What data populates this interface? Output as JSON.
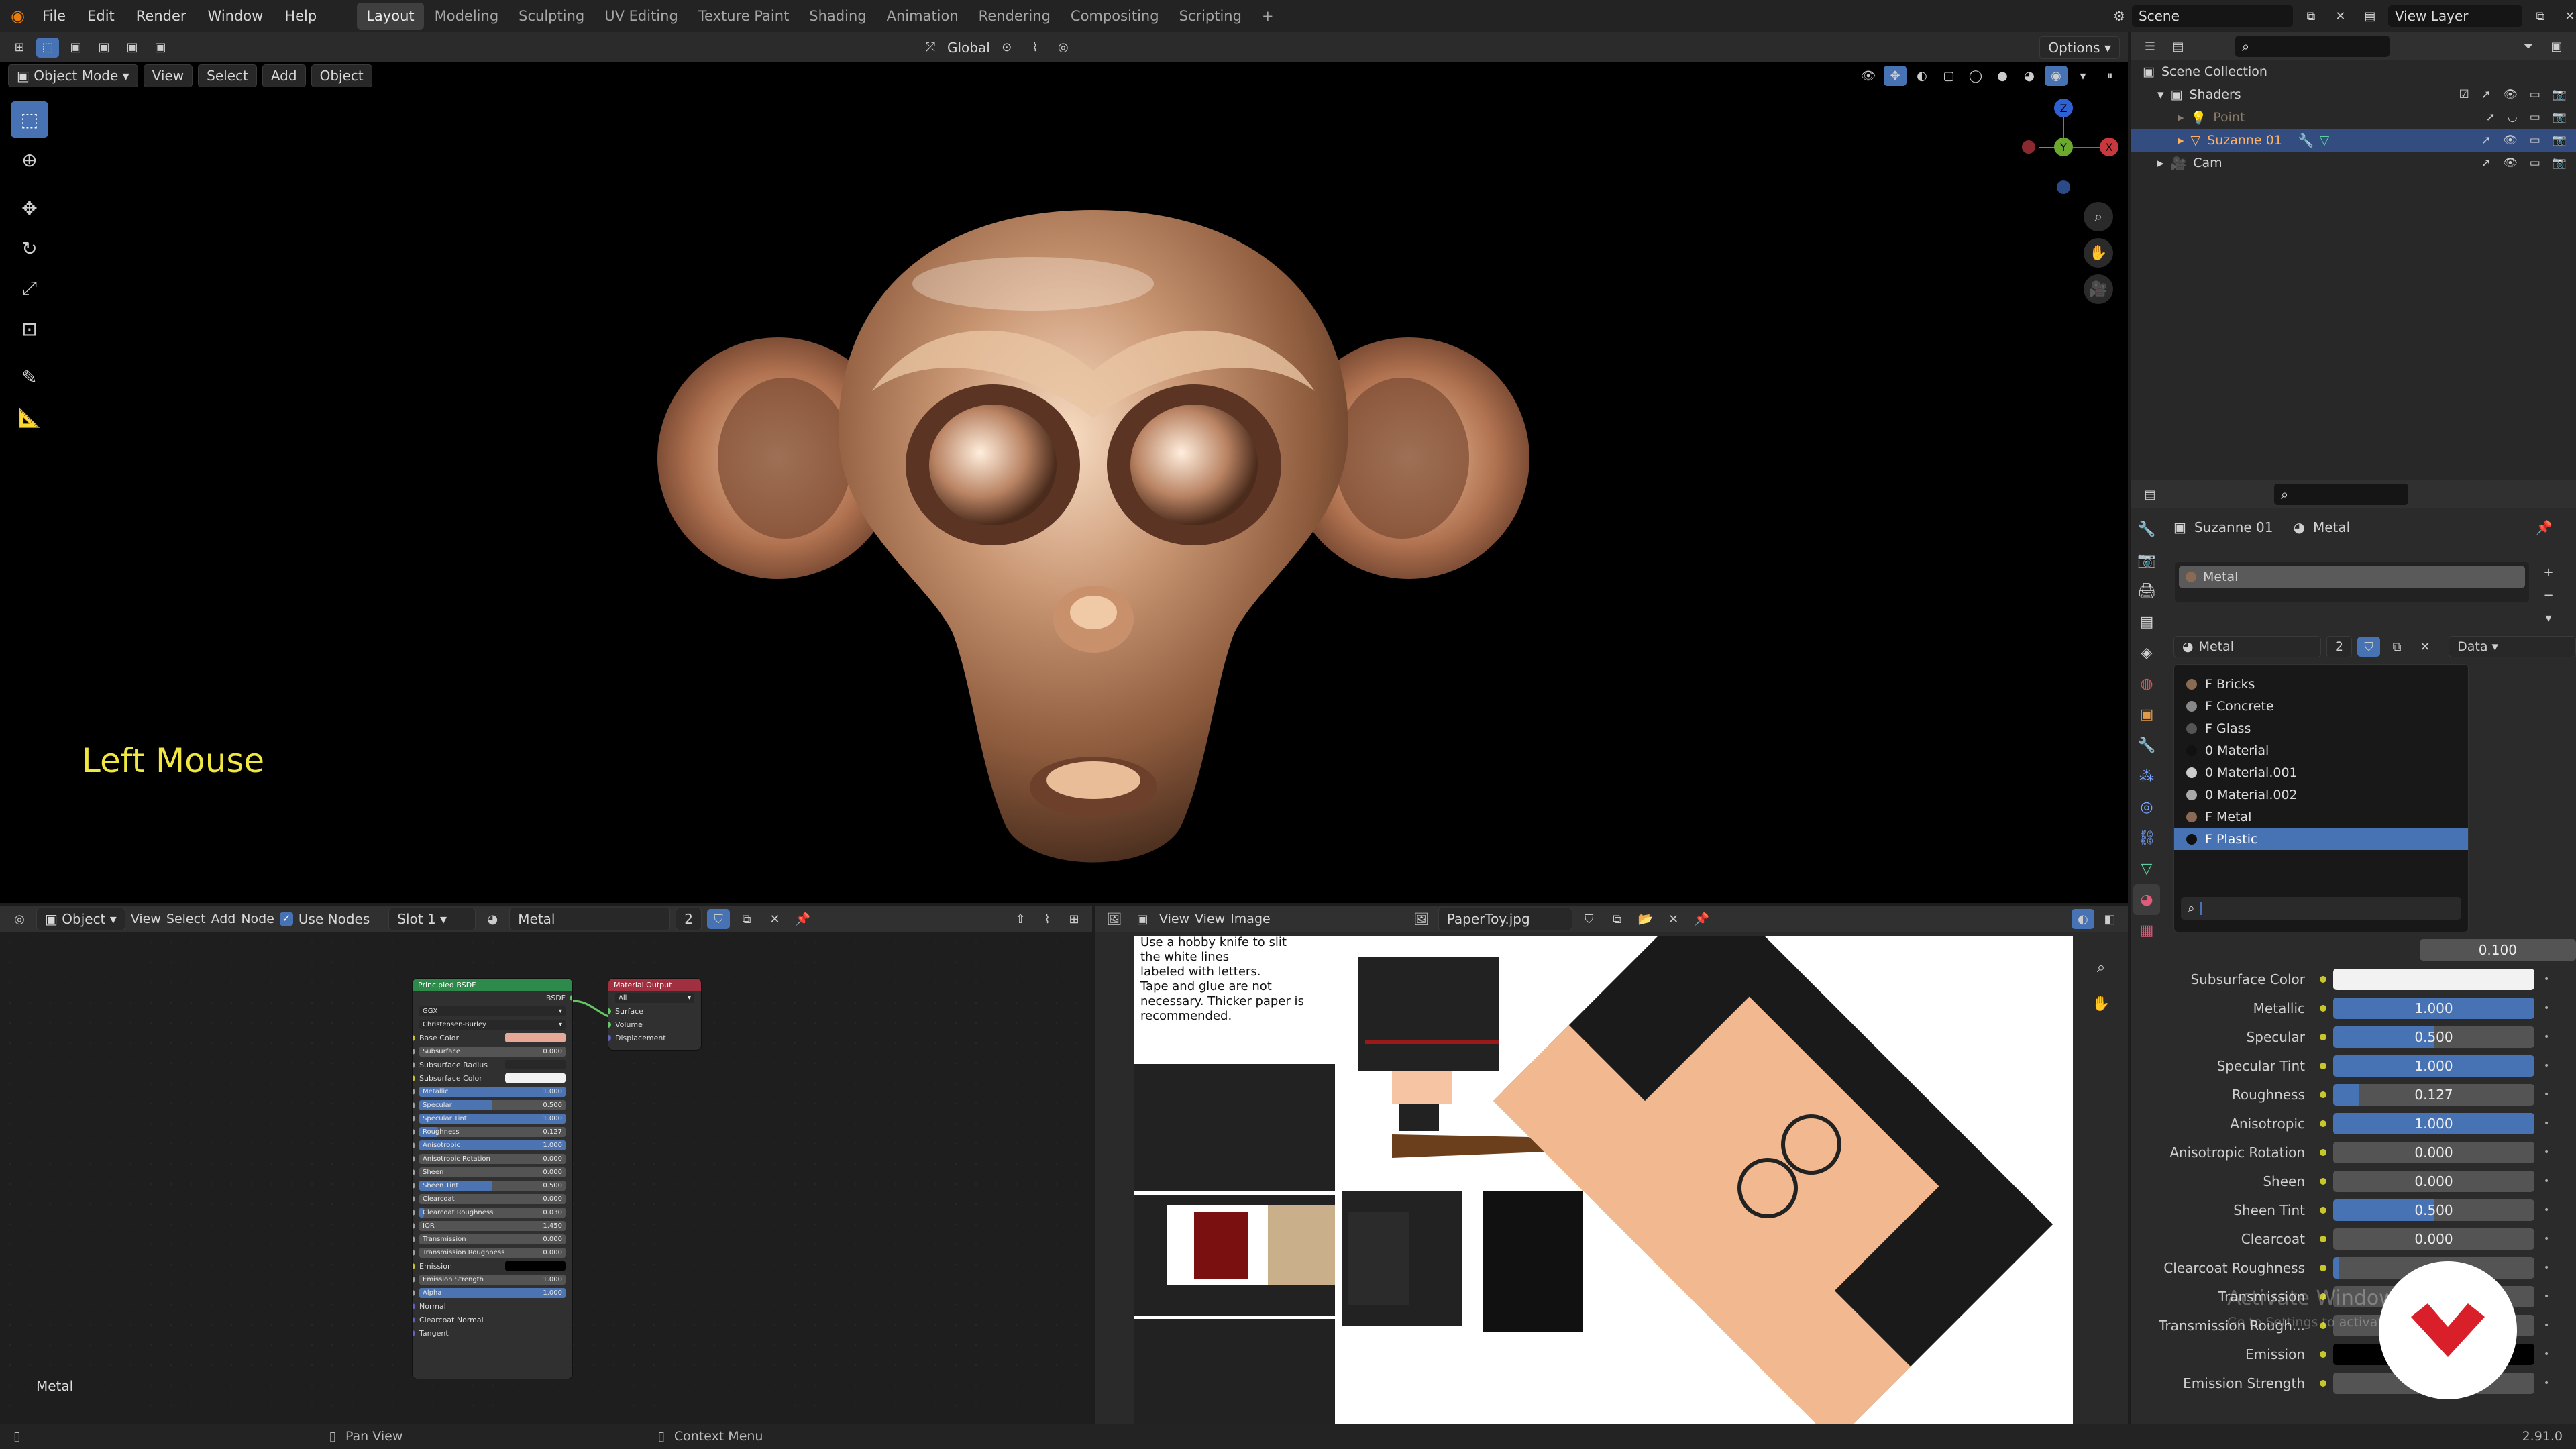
{
  "topbar": {
    "menus": [
      "File",
      "Edit",
      "Render",
      "Window",
      "Help"
    ],
    "workspaces": [
      "Layout",
      "Modeling",
      "Sculpting",
      "UV Editing",
      "Texture Paint",
      "Shading",
      "Animation",
      "Rendering",
      "Compositing",
      "Scripting"
    ],
    "active_workspace": "Layout",
    "scene": "Scene",
    "view_layer": "View Layer"
  },
  "viewport_header": {
    "mode": "Object Mode",
    "menus": [
      "View",
      "Select",
      "Add",
      "Object"
    ],
    "transform_orientation": "Global",
    "options_label": "Options"
  },
  "viewport": {
    "overlay_text": "Left Mouse",
    "overlay_text_color": "#f0e840",
    "gizmo": {
      "z": "Z",
      "y": "Y",
      "x": "X"
    }
  },
  "node_editor": {
    "editor_type": "Object",
    "menus": [
      "View",
      "Select",
      "Add",
      "Node"
    ],
    "use_nodes_label": "Use Nodes",
    "slot": "Slot 1",
    "material_name": "Metal",
    "user_count": "2",
    "footer_label": "Metal",
    "bsdf_node": {
      "title": "Principled BSDF",
      "output_label": "BSDF",
      "distribution": "GGX",
      "subsurface_method": "Christensen-Burley",
      "rows": [
        {
          "label": "Base Color",
          "type": "color",
          "color": "#e8a898"
        },
        {
          "label": "Subsurface",
          "value": "0.000"
        },
        {
          "label": "Subsurface Radius",
          "type": "select"
        },
        {
          "label": "Subsurface Color",
          "type": "color",
          "color": "#f2f2f2"
        },
        {
          "label": "Metallic",
          "value": "1.000",
          "fill": 1.0
        },
        {
          "label": "Specular",
          "value": "0.500",
          "fill": 0.5
        },
        {
          "label": "Specular Tint",
          "value": "1.000",
          "fill": 1.0
        },
        {
          "label": "Roughness",
          "value": "0.127",
          "fill": 0.127
        },
        {
          "label": "Anisotropic",
          "value": "1.000",
          "fill": 1.0
        },
        {
          "label": "Anisotropic Rotation",
          "value": "0.000"
        },
        {
          "label": "Sheen",
          "value": "0.000"
        },
        {
          "label": "Sheen Tint",
          "value": "0.500",
          "fill": 0.5
        },
        {
          "label": "Clearcoat",
          "value": "0.000"
        },
        {
          "label": "Clearcoat Roughness",
          "value": "0.030",
          "fill": 0.03
        },
        {
          "label": "IOR",
          "value": "1.450"
        },
        {
          "label": "Transmission",
          "value": "0.000"
        },
        {
          "label": "Transmission Roughness",
          "value": "0.000"
        },
        {
          "label": "Emission",
          "type": "color",
          "color": "#000000"
        },
        {
          "label": "Emission Strength",
          "value": "1.000"
        },
        {
          "label": "Alpha",
          "value": "1.000",
          "fill": 1.0
        },
        {
          "label": "Normal",
          "type": "socket"
        },
        {
          "label": "Clearcoat Normal",
          "type": "socket"
        },
        {
          "label": "Tangent",
          "type": "socket"
        }
      ]
    },
    "output_node": {
      "title": "Material Output",
      "target": "All",
      "inputs": [
        "Surface",
        "Volume",
        "Displacement"
      ]
    }
  },
  "image_editor": {
    "menus": [
      "View",
      "View",
      "Image"
    ],
    "image_name": "PaperToy.jpg",
    "instructions": [
      "Use a hobby knife to slit",
      "the white lines",
      "labeled with letters.",
      "Tape and glue are not",
      "necessary.  Thicker paper is",
      "recommended."
    ]
  },
  "outliner": {
    "root": "Scene Collection",
    "items": [
      {
        "name": "Shaders",
        "depth": 1,
        "icon": "collection-icon"
      },
      {
        "name": "Point",
        "depth": 2,
        "icon": "light-icon",
        "dim": true
      },
      {
        "name": "Suzanne 01",
        "depth": 2,
        "icon": "mesh-icon",
        "selected": true
      },
      {
        "name": "Cam",
        "depth": 1,
        "icon": "camera-icon"
      }
    ]
  },
  "properties": {
    "object_name": "Suzanne 01",
    "material_name": "Metal",
    "slot_name": "Metal",
    "browse_name": "Metal",
    "user_count": "2",
    "link": "Data",
    "dropdown_items": [
      {
        "name": "F Bricks",
        "color": "#8a6a55"
      },
      {
        "name": "F Concrete",
        "color": "#888888"
      },
      {
        "name": "F Glass",
        "color": "#555555"
      },
      {
        "name": "0 Material",
        "color": "#111111"
      },
      {
        "name": "0 Material.001",
        "color": "#cccccc"
      },
      {
        "name": "0 Material.002",
        "color": "#aaaaaa"
      },
      {
        "name": "F Metal",
        "color": "#8a6a55"
      },
      {
        "name": "F Plastic",
        "color": "#111111",
        "selected": true
      }
    ],
    "partial_value": "0.100",
    "rows": [
      {
        "label": "Subsurface Color",
        "type": "color",
        "color": "#f2f2f2"
      },
      {
        "label": "Metallic",
        "value": "1.000",
        "fill": 1.0
      },
      {
        "label": "Specular",
        "value": "0.500",
        "fill": 0.5
      },
      {
        "label": "Specular Tint",
        "value": "1.000",
        "fill": 1.0
      },
      {
        "label": "Roughness",
        "value": "0.127",
        "fill": 0.127
      },
      {
        "label": "Anisotropic",
        "value": "1.000",
        "fill": 1.0
      },
      {
        "label": "Anisotropic Rotation",
        "value": "0.000",
        "fill": 0
      },
      {
        "label": "Sheen",
        "value": "0.000",
        "fill": 0
      },
      {
        "label": "Sheen Tint",
        "value": "0.500",
        "fill": 0.5
      },
      {
        "label": "Clearcoat",
        "value": "0.000",
        "fill": 0
      },
      {
        "label": "Clearcoat Roughness",
        "value": "",
        "fill": 0.03
      },
      {
        "label": "Transmission",
        "value": "",
        "fill": 0
      },
      {
        "label": "Transmission Rough...",
        "value": "",
        "fill": 0
      },
      {
        "label": "Emission",
        "type": "color",
        "color": "#000000"
      },
      {
        "label": "Emission Strength",
        "value": "1.000",
        "fill": 0
      }
    ],
    "watermark_line1": "Activate Windows",
    "watermark_line2": "Go to Settings to activate Windows."
  },
  "statusbar": {
    "pan_view": "Pan View",
    "context_menu": "Context Menu",
    "version": "2.91.0"
  },
  "colors": {
    "accent": "#4772b3",
    "header": "#303030",
    "panel": "#2b2b2b"
  }
}
